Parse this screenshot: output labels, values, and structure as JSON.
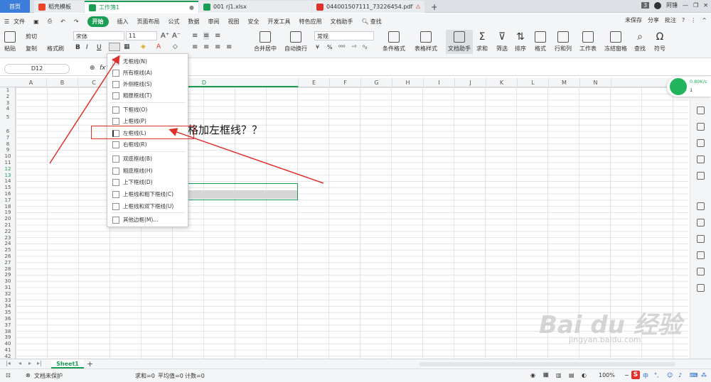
{
  "tabs": {
    "home": "首页",
    "t1": "稻壳模板",
    "t2": "工作簿1",
    "t3": "001 rj1.xlsx",
    "t4": "044001507111_73226454.pdf",
    "add": "+"
  },
  "titlebar": {
    "badge": "3",
    "user": "阿锤"
  },
  "menu": {
    "file": "文件",
    "start": "开始",
    "items": [
      "插入",
      "页面布局",
      "公式",
      "数据",
      "审阅",
      "视图",
      "安全",
      "开发工具",
      "特色应用",
      "文档助手"
    ],
    "search": "查找",
    "unsaved": "未保存",
    "share": "分享",
    "comment": "批注"
  },
  "ribbon": {
    "paste": "粘贴",
    "cut": "剪切",
    "copy": "复制",
    "format_painter": "格式刷",
    "font_name": "宋体",
    "font_size": "11",
    "bold": "B",
    "italic": "I",
    "underline": "U",
    "merge": "合并居中",
    "wrap": "自动换行",
    "num_format": "常规",
    "cond_format": "条件格式",
    "table_style": "表格样式",
    "doc_helper": "文档助手",
    "sum": "求和",
    "filter": "筛选",
    "sort": "排序",
    "format": "格式",
    "rowcol": "行和列",
    "worksheet": "工作表",
    "freeze": "冻结窗格",
    "find": "查找",
    "symbol": "符号"
  },
  "formula": {
    "namebox": "D12",
    "fx": "fx"
  },
  "columns": [
    "A",
    "B",
    "C",
    "D",
    "E",
    "F",
    "G",
    "H",
    "I",
    "J",
    "K",
    "L",
    "M",
    "N"
  ],
  "rows": [
    "1",
    "2",
    "3",
    "4",
    "5",
    "6",
    "7",
    "8",
    "9",
    "10",
    "11",
    "12",
    "13",
    "14",
    "15",
    "16",
    "17",
    "18",
    "19",
    "20",
    "21",
    "22",
    "23",
    "24",
    "25",
    "26",
    "27",
    "28",
    "29",
    "30",
    "31",
    "32",
    "33",
    "34",
    "35",
    "36",
    "37",
    "38",
    "39",
    "40",
    "41",
    "42"
  ],
  "cell_text": "格加左框线？？",
  "border_menu": [
    "无框线(N)",
    "所有框线(A)",
    "外侧框线(S)",
    "粗匣框线(T)",
    "下框线(O)",
    "上框线(P)",
    "左框线(L)",
    "右框线(R)",
    "双底框线(B)",
    "粗底框线(H)",
    "上下框线(D)",
    "上框线和粗下框线(C)",
    "上框线和双下框线(U)",
    "其他边框(M)..."
  ],
  "sheet": {
    "name": "Sheet1",
    "add": "+"
  },
  "status": {
    "protect": "文档未保护",
    "sum": "求和=0",
    "avg": "平均值=0",
    "count": "计数=0",
    "zoom": "100%",
    "ime": "中"
  },
  "network": {
    "speed": "0.80K/s",
    "count": "1"
  },
  "watermark": {
    "main": "Bai du 经验",
    "sub": "jingyan.baidu.com"
  },
  "colors": {
    "accent": "#1b9d54",
    "annotation": "#e0302c",
    "home_tab": "#3b7dd8"
  }
}
